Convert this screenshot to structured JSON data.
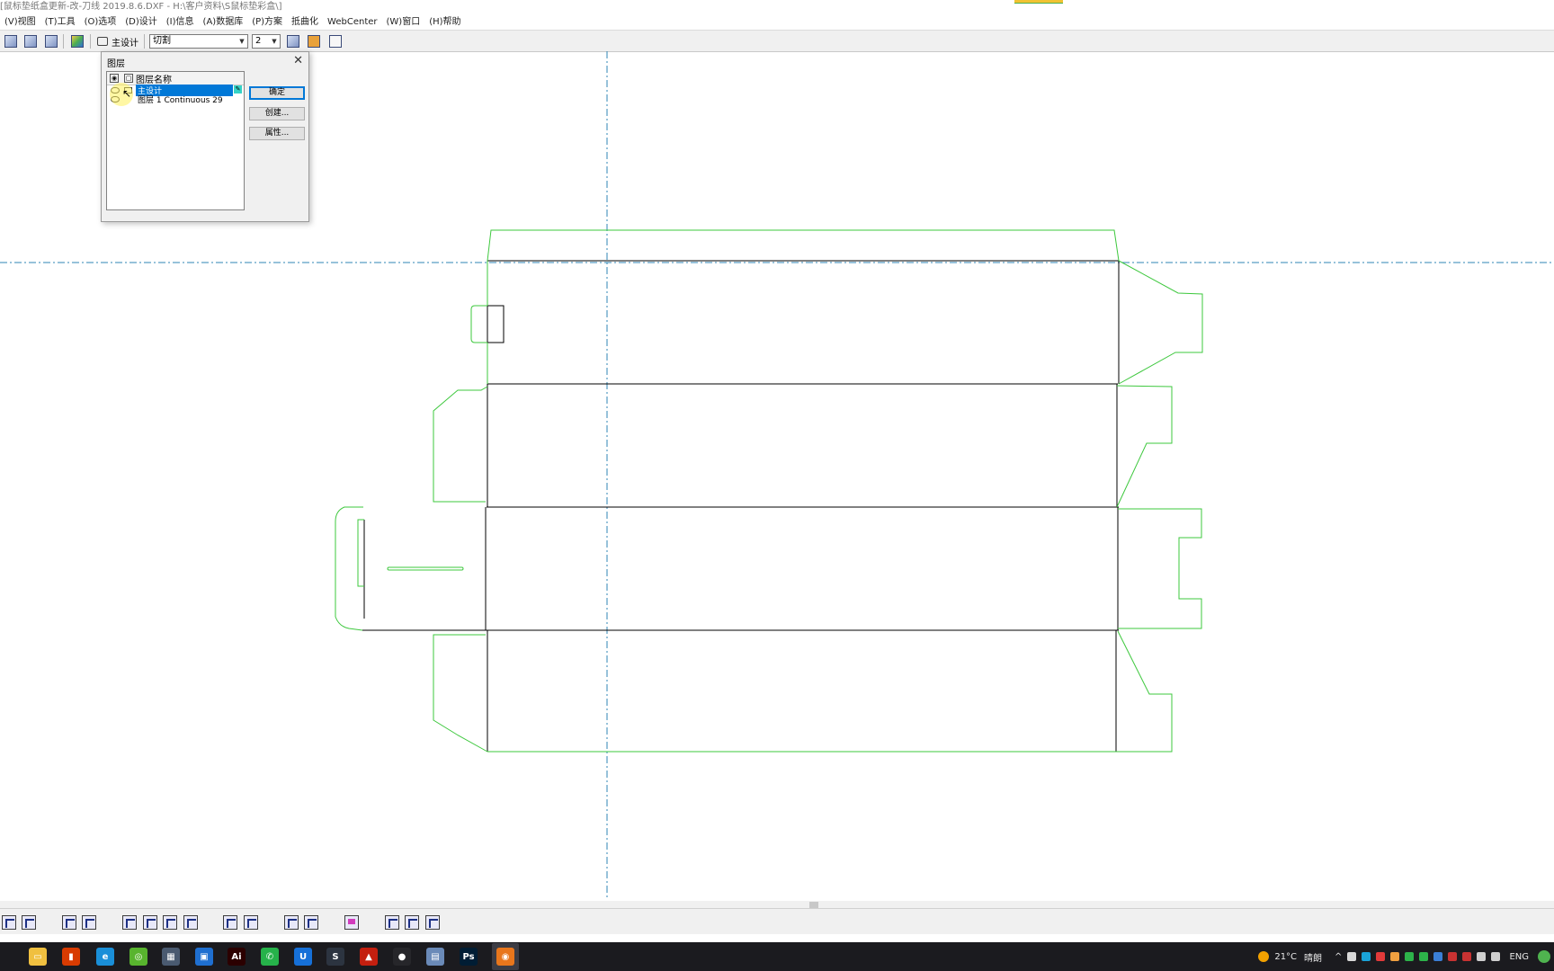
{
  "window": {
    "title": "[鼠标垫纸盒更新-改-刀线 2019.8.6.DXF - H:\\客户资料\\S鼠标垫彩盒\\]"
  },
  "menu": {
    "items": [
      "(V)视图",
      "(T)工具",
      "(O)选项",
      "(D)设计",
      "(I)信息",
      "(A)数据库",
      "(P)方案",
      "抵曲化",
      "WebCenter",
      "(W)窗口",
      "(H)帮助"
    ]
  },
  "toolbar": {
    "layer_label": "主设计",
    "line_type": "切割",
    "line_width": "2"
  },
  "layer_dialog": {
    "title": "图层",
    "header_label": "图层名称",
    "layers": [
      {
        "name": "主设计",
        "selected": true
      },
      {
        "name": "图层 1 Continuous 29",
        "selected": false
      }
    ],
    "ok_label": "确定",
    "create_label": "创建...",
    "properties_label": "属性..."
  },
  "drawing": {
    "cut_color": "#3ec83e",
    "crease_color": "#000000",
    "guide_color": "#2f86b6"
  },
  "taskbar": {
    "apps": [
      {
        "name": "file-explorer-icon",
        "color": "#f0c040",
        "glyph": "▭"
      },
      {
        "name": "office-icon",
        "color": "#d83b01",
        "glyph": "▮"
      },
      {
        "name": "edge-icon",
        "color": "#1a8fd8",
        "glyph": "e"
      },
      {
        "name": "browser-360-icon",
        "color": "#58b42e",
        "glyph": "◎"
      },
      {
        "name": "calculator-icon",
        "color": "#4a5a70",
        "glyph": "▦"
      },
      {
        "name": "store-icon",
        "color": "#1f6fd0",
        "glyph": "▣"
      },
      {
        "name": "illustrator-icon",
        "color": "#2b0000",
        "glyph": "Ai"
      },
      {
        "name": "wechat-icon",
        "color": "#26b24a",
        "glyph": "✆"
      },
      {
        "name": "uu-icon",
        "color": "#1670d8",
        "glyph": "U"
      },
      {
        "name": "sublime-icon",
        "color": "#2c3440",
        "glyph": "S"
      },
      {
        "name": "acrobat-icon",
        "color": "#c41f0f",
        "glyph": "▲"
      },
      {
        "name": "recorder-icon",
        "color": "#26262a",
        "glyph": "●"
      },
      {
        "name": "notepad-icon",
        "color": "#6a8ab8",
        "glyph": "▤"
      },
      {
        "name": "photoshop-icon",
        "color": "#001d34",
        "glyph": "Ps"
      },
      {
        "name": "artioscad-icon",
        "color": "#e8761c",
        "glyph": "◉"
      }
    ],
    "temperature": "21°C",
    "weather": "晴朗",
    "language": "ENG"
  }
}
